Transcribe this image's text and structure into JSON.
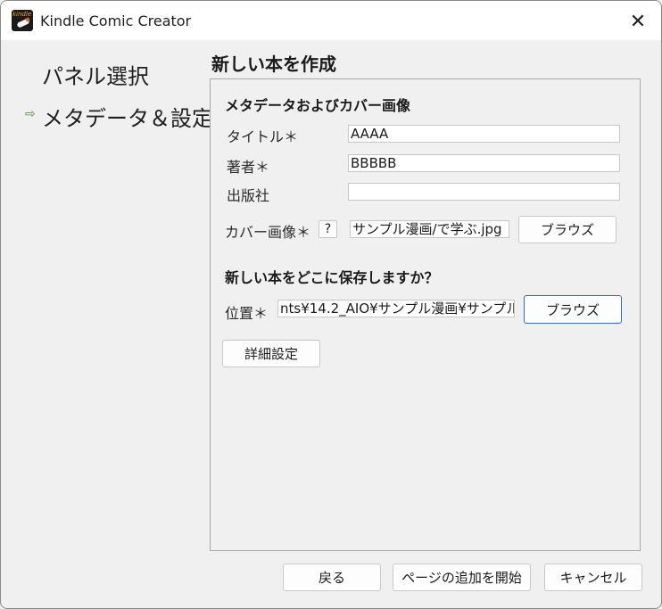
{
  "window": {
    "title": "Kindle Comic Creator",
    "app_icon_text": "kindle"
  },
  "sidebar": {
    "items": [
      {
        "label": "パネル選択",
        "current": false
      },
      {
        "label": "メタデータ＆設定",
        "current": true
      }
    ],
    "current_marker": "⇨"
  },
  "page_title": "新しい本を作成",
  "metadata": {
    "section_title": "メタデータおよびカバー画像",
    "title_label": "タイトル＊",
    "title_value": "AAAA",
    "author_label": "著者＊",
    "author_value": "BBBBB",
    "publisher_label": "出版社",
    "publisher_value": "",
    "cover_label": "カバー画像＊",
    "cover_help": "?",
    "cover_value": "サンプル漫画/で学ぶ.jpg",
    "cover_browse": "ブラウズ"
  },
  "save": {
    "section_title": "新しい本をどこに保存しますか？",
    "location_label": "位置＊",
    "location_value": "nts¥14.2_AIO¥サンプル漫画¥サンプル",
    "location_browse": "ブラウズ"
  },
  "advanced_button": "詳細設定",
  "footer": {
    "back": "戻る",
    "start_adding_pages": "ページの追加を開始",
    "cancel": "キャンセル"
  },
  "colors": {
    "focus_border": "#2f6fb8",
    "arrow": "#5a8a36",
    "icon_orange": "#ff9a1a"
  }
}
